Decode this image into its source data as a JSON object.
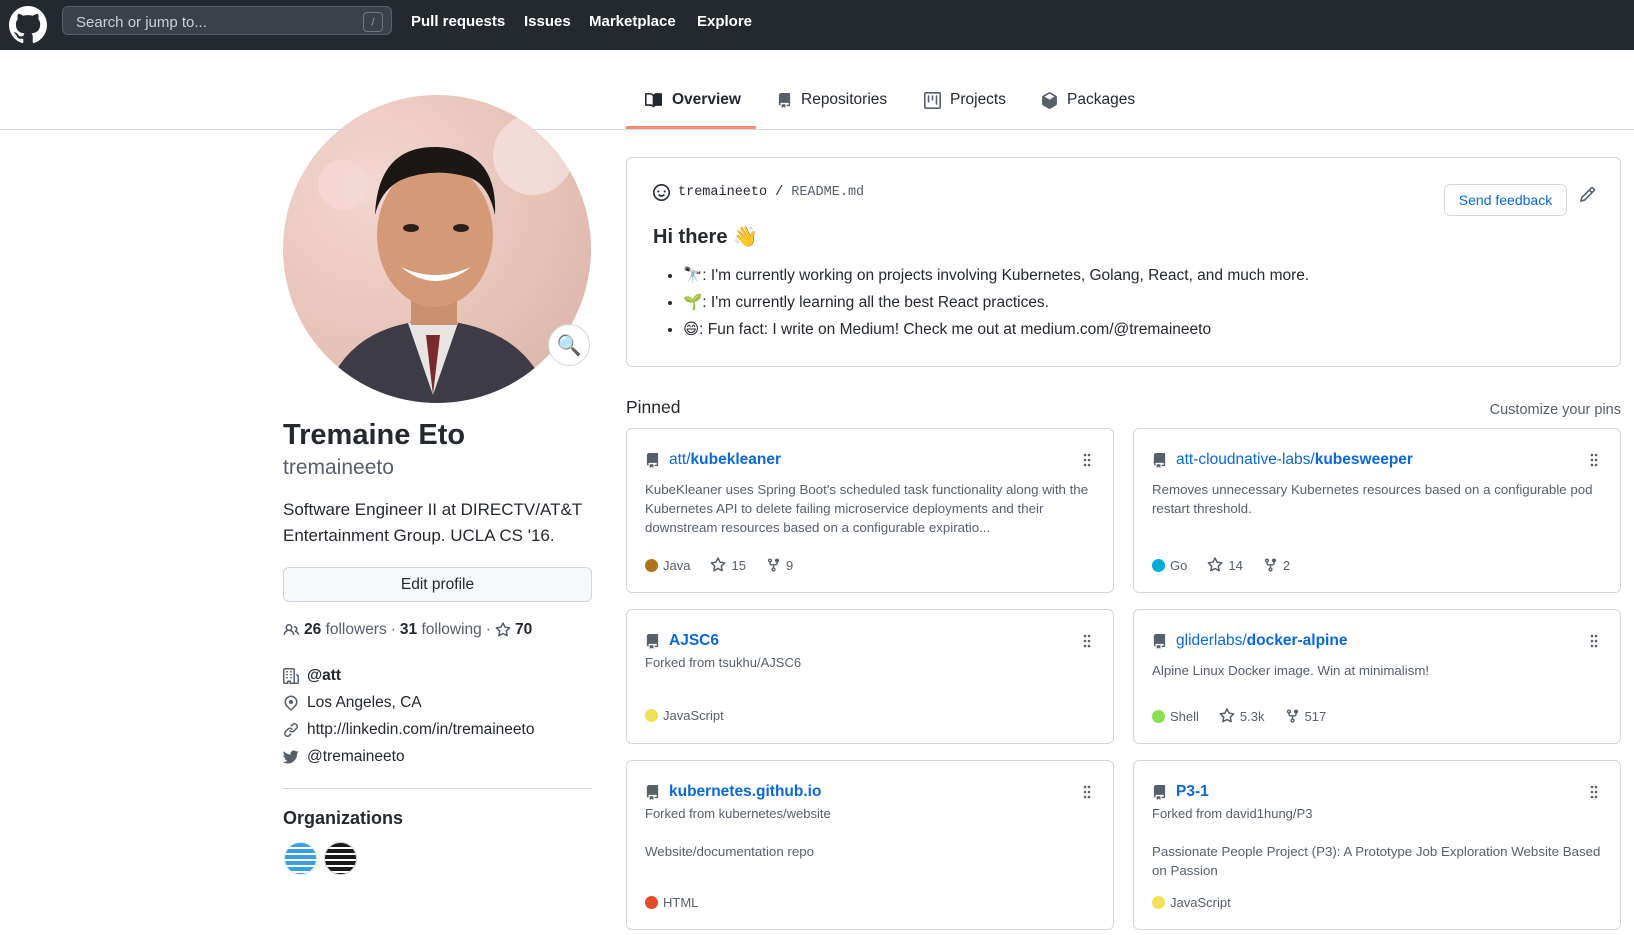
{
  "header": {
    "search_placeholder": "Search or jump to...",
    "slash_key": "/",
    "nav": [
      "Pull requests",
      "Issues",
      "Marketplace",
      "Explore"
    ]
  },
  "tabs": [
    {
      "label": "Overview",
      "icon": "book-icon",
      "active": true
    },
    {
      "label": "Repositories",
      "icon": "repo-icon",
      "active": false
    },
    {
      "label": "Projects",
      "icon": "project-icon",
      "active": false
    },
    {
      "label": "Packages",
      "icon": "package-icon",
      "active": false
    }
  ],
  "profile": {
    "name": "Tremaine Eto",
    "login": "tremaineeto",
    "bio": "Software Engineer II at DIRECTV/AT&T Entertainment Group. UCLA CS '16.",
    "edit_label": "Edit profile",
    "followers_count": "26",
    "followers_label": "followers",
    "sep": "·",
    "following_count": "31",
    "following_label": "following",
    "stars": "70",
    "company": "@att",
    "location": "Los Angeles, CA",
    "website": "http://linkedin.com/in/tremaineeto",
    "twitter": "@tremaineeto",
    "orgs_title": "Organizations"
  },
  "readme": {
    "owner": "tremaineeto",
    "slash": "/",
    "file": "README.md",
    "feedback_label": "Send feedback",
    "heading": "Hi there 👋",
    "items": [
      "🔭: I'm currently working on projects involving Kubernetes, Golang, React, and much more.",
      "🌱: I'm currently learning all the best React practices.",
      "😄: Fun fact: I write on Medium! Check me out at medium.com/@tremaineeto"
    ]
  },
  "pinned": {
    "title": "Pinned",
    "customize_label": "Customize your pins",
    "repos": [
      {
        "owner": "att/",
        "name": "kubekleaner",
        "forked": "",
        "desc": "KubeKleaner uses Spring Boot's scheduled task functionality along with the Kubernetes API to delete failing microservice deployments and their downstream resources based on a configurable expiratio...",
        "language": "Java",
        "lang_color": "#b07219",
        "stars": "15",
        "forks": "9"
      },
      {
        "owner": "att-cloudnative-labs/",
        "name": "kubesweeper",
        "forked": "",
        "desc": "Removes unnecessary Kubernetes resources based on a configurable pod restart threshold.",
        "language": "Go",
        "lang_color": "#00ADD8",
        "stars": "14",
        "forks": "2"
      },
      {
        "owner": "",
        "name": "AJSC6",
        "forked": "Forked from tsukhu/AJSC6",
        "desc": "",
        "language": "JavaScript",
        "lang_color": "#f1e05a",
        "stars": "",
        "forks": ""
      },
      {
        "owner": "gliderlabs/",
        "name": "docker-alpine",
        "forked": "",
        "desc": "Alpine Linux Docker image. Win at minimalism!",
        "language": "Shell",
        "lang_color": "#89e051",
        "stars": "5.3k",
        "forks": "517"
      },
      {
        "owner": "",
        "name": "kubernetes.github.io",
        "forked": "Forked from kubernetes/website",
        "desc": "Website/documentation repo",
        "language": "HTML",
        "lang_color": "#e34c26",
        "stars": "",
        "forks": ""
      },
      {
        "owner": "",
        "name": "P3-1",
        "forked": "Forked from david1hung/P3",
        "desc": "Passionate People Project (P3): A Prototype Job Exploration Website Based on Passion",
        "language": "JavaScript",
        "lang_color": "#f1e05a",
        "stars": "",
        "forks": ""
      }
    ]
  }
}
